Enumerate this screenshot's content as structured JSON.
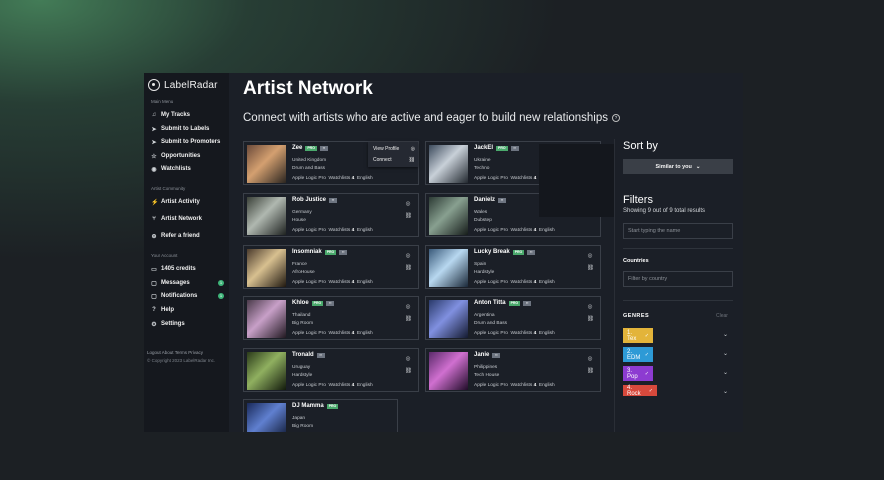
{
  "sidebar": {
    "logo": "LabelRadar",
    "main_menu_title": "Main Menu",
    "main_menu": [
      {
        "label": "My Tracks",
        "icon": "music-note-icon"
      },
      {
        "label": "Submit to Labels",
        "icon": "send-icon"
      },
      {
        "label": "Submit to Promoters",
        "icon": "send-icon"
      },
      {
        "label": "Opportunities",
        "icon": "star-icon"
      },
      {
        "label": "Watchlists",
        "icon": "eye-icon"
      }
    ],
    "community_title": "Artist Community",
    "community": [
      {
        "label": "Artist Activity",
        "icon": "activity-icon"
      },
      {
        "label": "Artist Network",
        "icon": "network-icon"
      },
      {
        "label": "Refer a friend",
        "icon": "plus-circle-icon"
      }
    ],
    "account_title": "Your Account",
    "account": [
      {
        "label": "1405 credits",
        "icon": "ticket-icon"
      },
      {
        "label": "Messages",
        "icon": "chat-icon",
        "badge": "1"
      },
      {
        "label": "Notifications",
        "icon": "bell-icon",
        "badge": "1"
      },
      {
        "label": "Help",
        "icon": "question-icon"
      },
      {
        "label": "Settings",
        "icon": "gear-icon"
      }
    ],
    "footer_links": "Logout About Terms Privacy",
    "copyright": "© Copyright 2023 LabelRadar Inc."
  },
  "main": {
    "title": "Artist Network",
    "subtitle": "Connect with artists who are active and eager to build new relationships",
    "popup": {
      "view_profile": "View Profile",
      "connect": "Connect"
    },
    "cards": [
      {
        "name": "Zee",
        "pro": "PRO",
        "country": "United Kingdom",
        "genre": "Drum and Bass",
        "daw": "Apple Logic Pro",
        "watchlists_label": "Watchlists",
        "watchlists": "4",
        "lang": "English"
      },
      {
        "name": "JackEl",
        "pro": "PRO",
        "country": "Ukraine",
        "genre": "Techno",
        "daw": "Apple Logic Pro",
        "watchlists_label": "Watchlists",
        "watchlists": "4",
        "lang": "English"
      },
      {
        "name": "Rob Justice",
        "pro": "",
        "country": "Germany",
        "genre": "House",
        "daw": "Apple Logic Pro",
        "watchlists_label": "Watchlists",
        "watchlists": "4",
        "lang": "English"
      },
      {
        "name": "Danielz",
        "pro": "",
        "country": "Wales",
        "genre": "Dubstep",
        "daw": "Apple Logic Pro",
        "watchlists_label": "Watchlists",
        "watchlists": "4",
        "lang": "English"
      },
      {
        "name": "Insomniak",
        "pro": "PRO",
        "country": "France",
        "genre": "AfroHouse",
        "daw": "Apple Logic Pro",
        "watchlists_label": "Watchlists",
        "watchlists": "4",
        "lang": "English"
      },
      {
        "name": "Lucky Break",
        "pro": "PRO",
        "country": "Spain",
        "genre": "Hardstyle",
        "daw": "Apple Logic Pro",
        "watchlists_label": "Watchlists",
        "watchlists": "4",
        "lang": "English"
      },
      {
        "name": "Khloe",
        "pro": "PRO",
        "country": "Thailand",
        "genre": "Big Room",
        "daw": "Apple Logic Pro",
        "watchlists_label": "Watchlists",
        "watchlists": "4",
        "lang": "English"
      },
      {
        "name": "Anton Titta",
        "pro": "PRO",
        "country": "Argentina",
        "genre": "Drum and Bass",
        "daw": "Apple Logic Pro",
        "watchlists_label": "Watchlists",
        "watchlists": "4",
        "lang": "English"
      },
      {
        "name": "Tronald",
        "pro": "",
        "country": "Uruguay",
        "genre": "Hardstyle",
        "daw": "Apple Logic Pro",
        "watchlists_label": "Watchlists",
        "watchlists": "4",
        "lang": "English"
      },
      {
        "name": "Janie",
        "pro": "",
        "country": "Philippines",
        "genre": "Tech House",
        "daw": "Apple Logic Pro",
        "watchlists_label": "Watchlists",
        "watchlists": "4",
        "lang": "English"
      },
      {
        "name": "DJ Mamma",
        "pro": "PRO",
        "country": "Japan",
        "genre": "Big Room",
        "daw": "",
        "watchlists_label": "",
        "watchlists": "",
        "lang": ""
      }
    ]
  },
  "right": {
    "sort_title": "Sort by",
    "sort_value": "Similar to you",
    "filters_title": "Filters",
    "showing": "Showing 9 out of 9 total results",
    "name_placeholder": "Start typing the name",
    "countries_label": "Countries",
    "country_placeholder": "Filter by country",
    "genres_label": "GENRES",
    "clear": "Clear",
    "genres": [
      {
        "label": "1. Tex",
        "color": "#e3b43a"
      },
      {
        "label": "2. EDM",
        "color": "#2d9ad6"
      },
      {
        "label": "3. Pop",
        "color": "#8d3bd1"
      },
      {
        "label": "4. Rock",
        "color": "#d7493c"
      }
    ]
  }
}
